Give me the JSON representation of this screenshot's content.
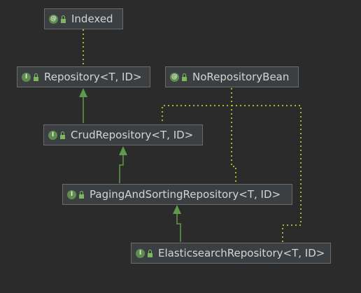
{
  "nodes": {
    "indexed": {
      "label": "Indexed",
      "kind_icon": "annotation-icon",
      "kind_glyph": "@",
      "visibility_icon": "public-lock-icon"
    },
    "repository": {
      "label": "Repository<T, ID>",
      "kind_icon": "interface-icon",
      "kind_glyph": "I",
      "visibility_icon": "public-lock-icon"
    },
    "no_repository_bean": {
      "label": "NoRepositoryBean",
      "kind_icon": "annotation-icon",
      "kind_glyph": "@",
      "visibility_icon": "public-lock-icon"
    },
    "crud_repository": {
      "label": "CrudRepository<T, ID>",
      "kind_icon": "interface-icon",
      "kind_glyph": "I",
      "visibility_icon": "public-lock-icon"
    },
    "paging_and_sorting_repository": {
      "label": "PagingAndSortingRepository<T, ID>",
      "kind_icon": "interface-icon",
      "kind_glyph": "I",
      "visibility_icon": "public-lock-icon"
    },
    "elasticsearch_repository": {
      "label": "ElasticsearchRepository<T, ID>",
      "kind_icon": "interface-icon",
      "kind_glyph": "I",
      "visibility_icon": "public-lock-icon"
    }
  },
  "colors": {
    "background": "#2b2b2b",
    "node_fill": "#3c3f41",
    "node_border": "#6b6b6b",
    "text": "#d4d4d4",
    "extends_edge": "#5f9a4a",
    "annotation_edge": "#a6b82e",
    "icon_fill": "#5f8d4e"
  }
}
